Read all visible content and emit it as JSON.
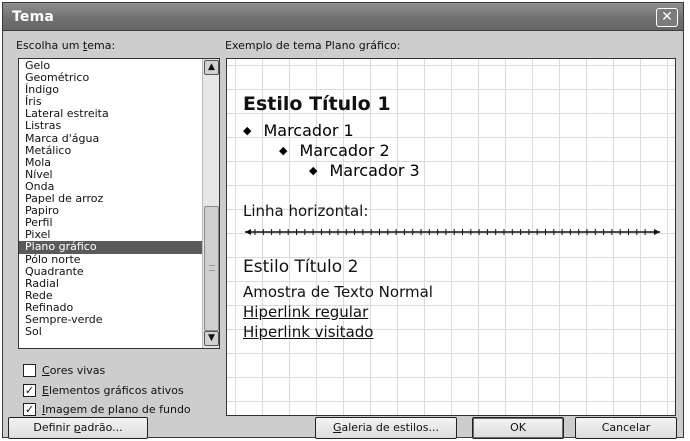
{
  "window": {
    "title": "Tema",
    "close_label": "✕"
  },
  "theme_list": {
    "label_prefix": "Escolha um ",
    "label_accel": "t",
    "label_suffix": "ema:",
    "items": [
      "Gelo",
      "Geométrico",
      "Índigo",
      "Íris",
      "Lateral estreita",
      "Listras",
      "Marca d'água",
      "Metálico",
      "Mola",
      "Nível",
      "Onda",
      "Papel de arroz",
      "Papiro",
      "Perfil",
      "Pixel",
      "Plano gráfico",
      "Pólo norte",
      "Quadrante",
      "Radial",
      "Rede",
      "Refinado",
      "Sempre-verde",
      "Sol"
    ],
    "selected": "Plano gráfico",
    "scroll_up": "▲",
    "scroll_down": "▼"
  },
  "preview": {
    "label": "Exemplo de tema Plano gráfico:",
    "title1": "Estilo Título 1",
    "bullet_glyph": "◆",
    "bullets": [
      "Marcador 1",
      "Marcador 2",
      "Marcador 3"
    ],
    "hr_label": "Linha horizontal:",
    "title2": "Estilo Título 2",
    "normal_text": "Amostra de Texto Normal",
    "link_regular": "Hiperlink regular",
    "link_visited": "Hiperlink visitado"
  },
  "options": {
    "vivid_colors": {
      "accel": "C",
      "rest": "ores vivas",
      "checked": false
    },
    "active_graphics": {
      "accel": "E",
      "rest": "lementos gráficos ativos",
      "checked": true
    },
    "background_image": {
      "accel": "I",
      "rest": "magem de plano de fundo",
      "checked": true
    },
    "check_glyph": "✓"
  },
  "buttons": {
    "set_default": {
      "accel_prefix": "Definir ",
      "accel": "p",
      "rest": "adrão..."
    },
    "style_gallery": {
      "accel": "G",
      "rest": "aleria de estilos..."
    },
    "ok": "OK",
    "cancel": "Cancelar"
  }
}
